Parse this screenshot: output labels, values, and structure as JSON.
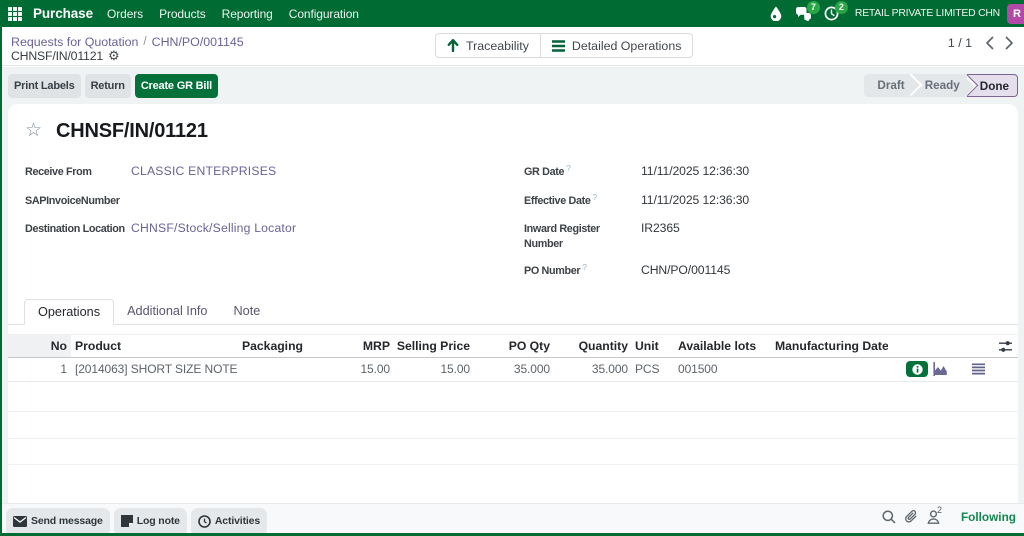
{
  "navbar": {
    "app_name": "Purchase",
    "menus": [
      "Orders",
      "Products",
      "Reporting",
      "Configuration"
    ],
    "messages_badge": "7",
    "activities_badge": "2",
    "company": "RETAIL PRIVATE LIMITED CHN",
    "avatar_initial": "R"
  },
  "breadcrumb": {
    "parent": "Requests for Quotation",
    "separator": "/",
    "origin": "CHN/PO/001145",
    "current": "CHNSF/IN/01121"
  },
  "view_buttons": {
    "traceability": "Traceability",
    "detailed_operations": "Detailed Operations"
  },
  "pager": {
    "value": "1 / 1"
  },
  "actions": {
    "print_labels": "Print Labels",
    "return": "Return",
    "create_gr_bill": "Create GR Bill"
  },
  "statusbar": {
    "steps": [
      "Draft",
      "Ready",
      "Done"
    ],
    "active_step": "Done"
  },
  "record": {
    "title": "CHNSF/IN/01121"
  },
  "fields": {
    "receive_from": {
      "label": "Receive From",
      "value": "CLASSIC ENTERPRISES"
    },
    "sap_invoice_number": {
      "label": "SAPInvoiceNumber",
      "value": ""
    },
    "destination_location": {
      "label": "Destination Location",
      "value": "CHNSF/Stock/Selling Locator"
    },
    "gr_date": {
      "label": "GR Date",
      "help": "?",
      "value": "11/11/2025 12:36:30"
    },
    "effective_date": {
      "label": "Effective Date",
      "help": "?",
      "value": "11/11/2025 12:36:30"
    },
    "inward_register_number": {
      "label": "Inward Register Number",
      "value": "IR2365"
    },
    "po_number": {
      "label": "PO Number",
      "help": "?",
      "value": "CHN/PO/001145"
    }
  },
  "tabs": [
    "Operations",
    "Additional Info",
    "Note"
  ],
  "table": {
    "headers": {
      "no": "No",
      "product": "Product",
      "packaging": "Packaging",
      "mrp": "MRP",
      "selling_price": "Selling Price",
      "po_qty": "PO Qty",
      "quantity": "Quantity",
      "unit": "Unit",
      "available_lots": "Available lots",
      "manufacturing_date": "Manufacturing Date"
    },
    "rows": [
      {
        "no": "1",
        "product": "[2014063] SHORT SIZE NOTE",
        "packaging": "",
        "mrp": "15.00",
        "selling_price": "15.00",
        "po_qty": "35.000",
        "quantity": "35.000",
        "unit": "PCS",
        "available_lots": "001500",
        "manufacturing_date": ""
      }
    ]
  },
  "chatter": {
    "send_message": "Send message",
    "log_note": "Log note",
    "activities": "Activities",
    "followers_count": "2",
    "following": "Following"
  },
  "icons": {
    "gear_glyph": "⚙",
    "star_glyph": "☆"
  },
  "colors": {
    "brand_green": "#006b33",
    "badge_green": "#28a745",
    "following_green": "#12884e",
    "avatar_magenta": "#b348a8",
    "link_violet": "#6a6399",
    "done_border_purple": "#7a6592"
  }
}
